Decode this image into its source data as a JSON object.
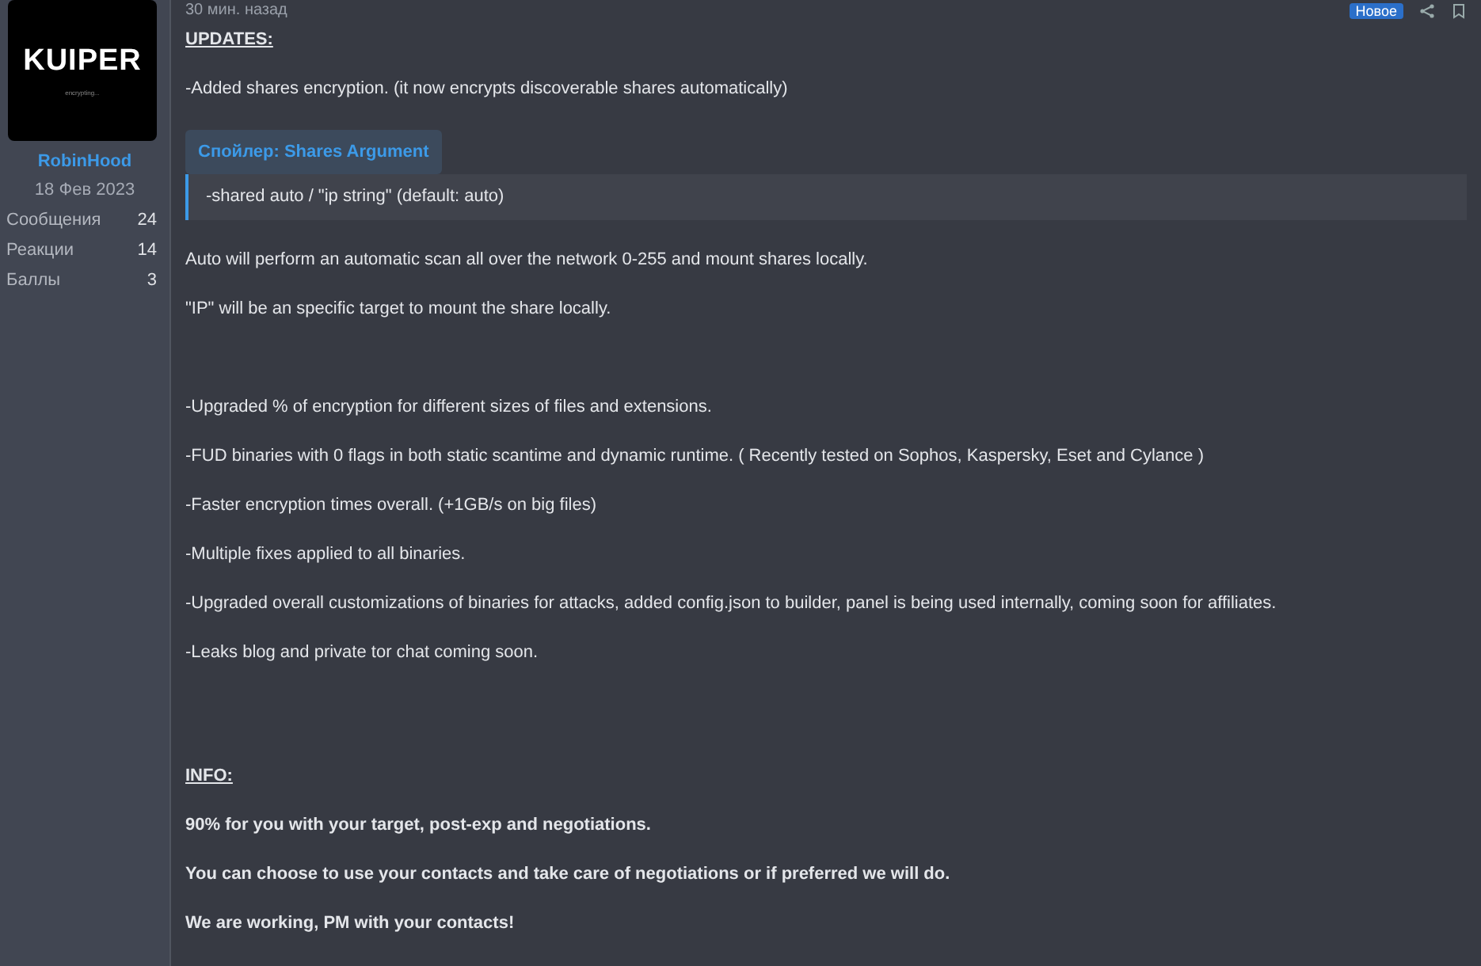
{
  "author": {
    "avatar_text": "KUIPER",
    "avatar_subtext": "encrypting...",
    "name": "RobinHood",
    "joined": "18 Фев 2023",
    "stats": [
      {
        "label": "Сообщения",
        "value": "24"
      },
      {
        "label": "Реакции",
        "value": "14"
      },
      {
        "label": "Баллы",
        "value": "3"
      }
    ]
  },
  "post": {
    "time": "30 мин. назад",
    "badge": "Новое",
    "sections": [
      {
        "blocks": [
          {
            "kind": "heading",
            "text": "UPDATES:"
          },
          {
            "kind": "text",
            "text": "-Added shares encryption. (it now encrypts discoverable shares automatically)"
          },
          {
            "kind": "spoiler",
            "title": "Спойлер: Shares Argument",
            "text": "-shared auto / \"ip string\" (default: auto)"
          },
          {
            "kind": "text",
            "text": "Auto will perform an automatic scan all over the network 0-255 and mount shares locally."
          },
          {
            "kind": "text",
            "text": "\"IP\" will be an specific target to mount the share locally."
          }
        ]
      },
      {
        "blocks": [
          {
            "kind": "text",
            "text": "-Upgraded % of encryption for different sizes of files and extensions."
          },
          {
            "kind": "text",
            "text": "-FUD binaries with 0 flags in both static scantime and dynamic runtime. ( Recently tested on Sophos, Kaspersky, Eset and Cylance )"
          },
          {
            "kind": "text",
            "text": "-Faster encryption times overall. (+1GB/s on big files)"
          },
          {
            "kind": "text",
            "text": "-Multiple fixes applied to all binaries."
          },
          {
            "kind": "text",
            "text": "-Upgraded overall customizations of binaries for attacks, added config.json to builder, panel is being used internally, coming soon for affiliates."
          },
          {
            "kind": "text",
            "text": "-Leaks blog and private tor chat coming soon."
          }
        ]
      },
      {
        "blocks": [
          {
            "kind": "heading",
            "text": "INFO:"
          },
          {
            "kind": "bold",
            "text": "90% for you with your target, post-exp and negotiations."
          },
          {
            "kind": "bold",
            "text": "You can choose to use your contacts and take care of negotiations or if preferred we will do."
          },
          {
            "kind": "bold",
            "text": "We are working, PM with your contacts!"
          }
        ]
      }
    ]
  }
}
